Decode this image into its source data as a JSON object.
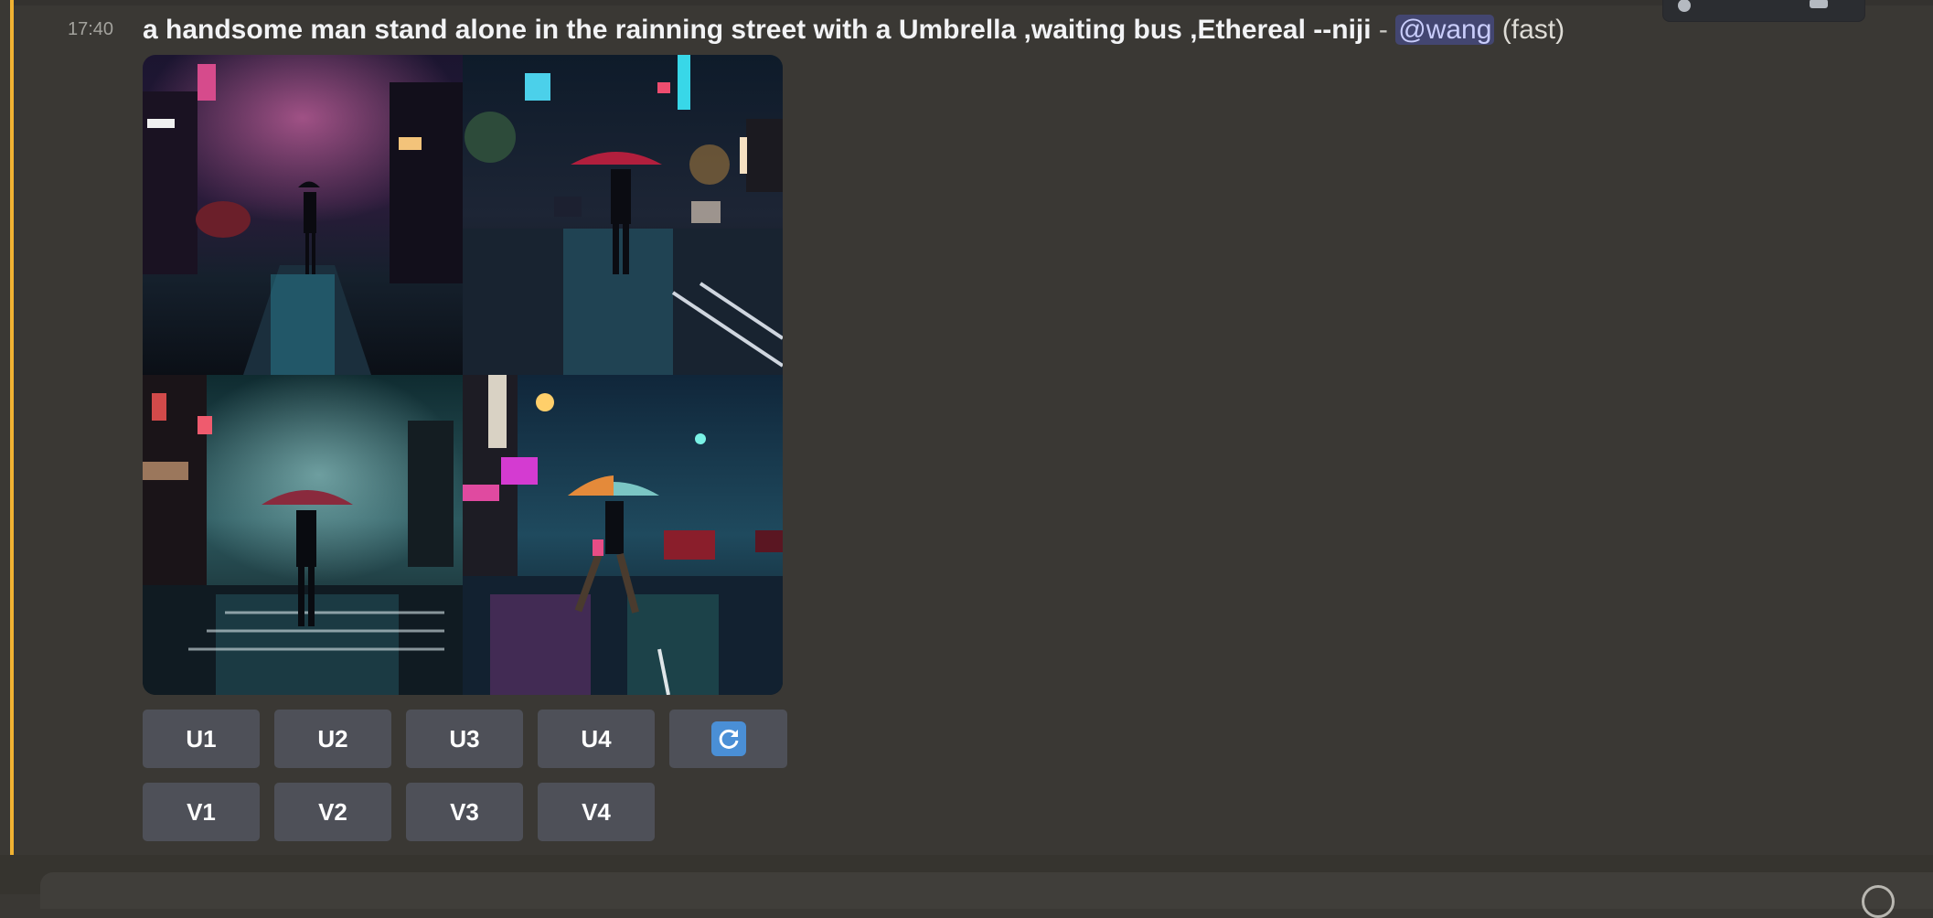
{
  "message": {
    "timestamp": "17:40",
    "prompt": "a handsome man stand alone in the rainning street with a Umbrella ,waiting bus ,Ethereal --niji",
    "separator": " - ",
    "mention": "@wang",
    "speed": "(fast)"
  },
  "image_grid": {
    "images": [
      {
        "index": 1,
        "description": "figure with umbrella walking down neon-lit rainy street"
      },
      {
        "index": 2,
        "description": "man with red umbrella on rainy city crosswalk"
      },
      {
        "index": 3,
        "description": "man with umbrella standing at crosswalk in teal fog"
      },
      {
        "index": 4,
        "description": "person with colorful umbrella crossing rainy street"
      }
    ]
  },
  "buttons": {
    "upscale": [
      "U1",
      "U2",
      "U3",
      "U4"
    ],
    "variation": [
      "V1",
      "V2",
      "V3",
      "V4"
    ],
    "reroll_icon": "refresh-icon"
  },
  "colors": {
    "highlight": "#f0b232",
    "mention_bg": "#5865f2",
    "button_bg": "#4e5058",
    "background": "#3a3834"
  }
}
